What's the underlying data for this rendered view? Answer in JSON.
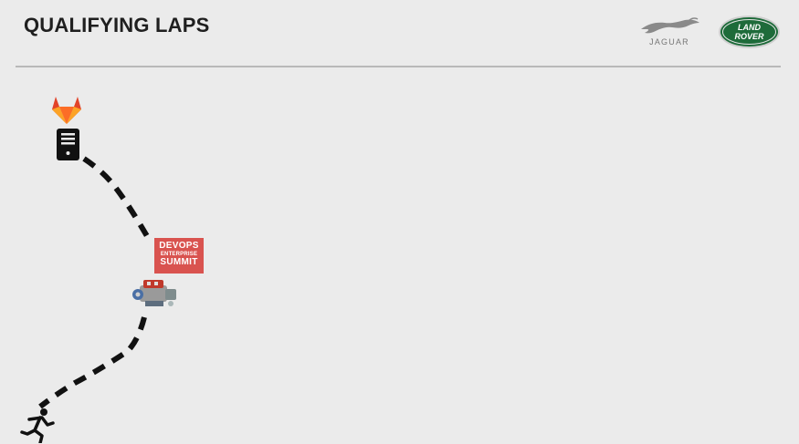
{
  "slide": {
    "title": "QUALIFYING LAPS"
  },
  "brands": {
    "jaguar": {
      "wordmark": "JAGUAR",
      "icon": "leaping-jaguar-icon"
    },
    "land_rover": {
      "line1": "LAND",
      "line2": "ROVER",
      "color": "#1e6b3a"
    }
  },
  "badge": {
    "line1": "DEVOPS",
    "line2": "ENTERPRISE",
    "line3": "SUMMIT",
    "color": "#d9534f"
  },
  "icons": {
    "gitlab": "gitlab-fox-icon",
    "server": "server-icon",
    "engine": "engine-icon",
    "runner": "runner-icon"
  },
  "colors": {
    "background": "#ebebeb",
    "path": "#111111"
  }
}
